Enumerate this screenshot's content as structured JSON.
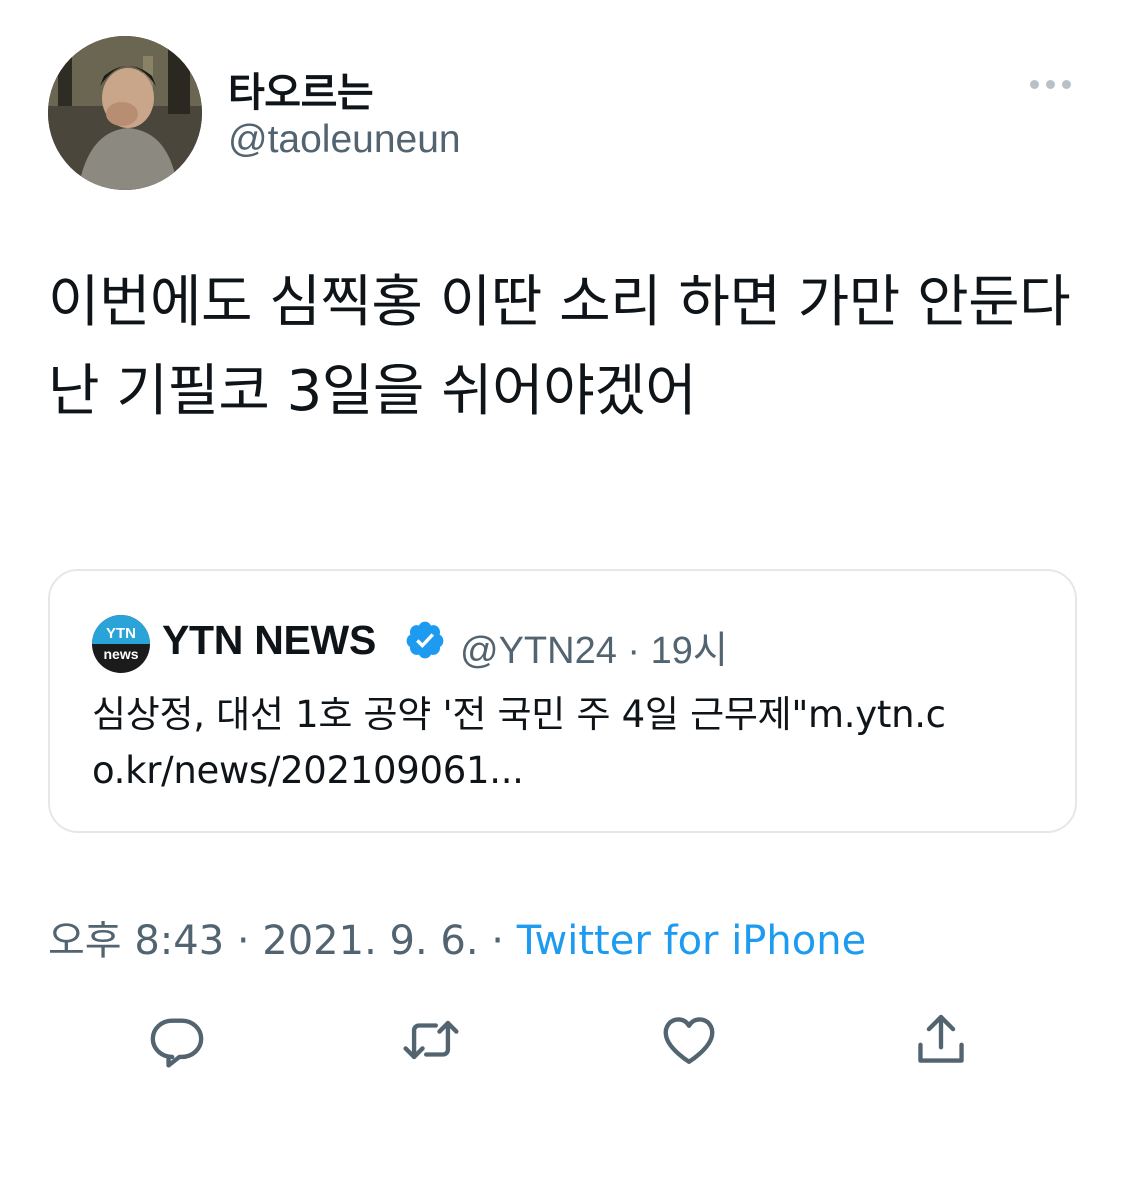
{
  "author": {
    "display_name": "타오르는",
    "handle": "@taoleuneun"
  },
  "tweet": {
    "text": "이번에도 심찍홍 이딴 소리 하면 가만 안둔다\n난 기필코 3일을 쉬어야겠어"
  },
  "quote": {
    "logo_top": "YTN",
    "logo_bottom": "news",
    "display_name": "YTN NEWS",
    "verified": true,
    "handle_time": "@YTN24 · 19시",
    "text": "심상정, 대선 1호 공약 '전 국민 주 4일 근무제\"m.ytn.co.kr/news/202109061..."
  },
  "meta": {
    "timestamp": "오후 8:43 · 2021. 9. 6. · ",
    "source": "Twitter for iPhone"
  },
  "actions": {
    "reply_icon": "reply-icon",
    "retweet_icon": "retweet-icon",
    "like_icon": "heart-icon",
    "share_icon": "share-icon"
  },
  "colors": {
    "link": "#1d9bf0",
    "secondary_text": "#536471",
    "verified": "#1d9bf0",
    "icon": "#536471"
  }
}
